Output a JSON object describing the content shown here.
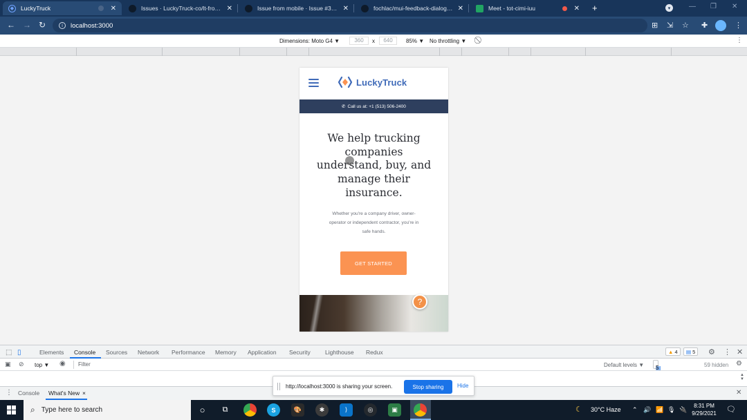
{
  "browser": {
    "tabs": [
      {
        "title": "LuckyTruck",
        "active": true
      },
      {
        "title": "Issues · LuckyTruck-co/lt-frontend",
        "active": false
      },
      {
        "title": "Issue from mobile · Issue #32 · LuckyTruck-co",
        "active": false
      },
      {
        "title": "fochlac/mui-feedback-dialog: A React",
        "active": false
      },
      {
        "title": "Meet - tot-cimi-iuu",
        "active": false
      }
    ],
    "new_tab": "+",
    "url": "localhost:3000"
  },
  "device_toolbar": {
    "dimensions_label": "Dimensions: Moto G4 ▼",
    "width": "360",
    "times": "x",
    "height": "640",
    "zoom": "85% ▼",
    "throttle": "No throttling ▼"
  },
  "site": {
    "brand": "LuckyTruck",
    "call_bar": "Call us at: +1 (513) 506-2400",
    "hero_lines": [
      "We help trucking",
      "companies",
      "understand, buy, and",
      "manage their",
      "insurance."
    ],
    "sub_lines": [
      "Whether you're a company driver, owner-",
      "operator or independent contractor, you're in",
      "safe hands."
    ],
    "cta": "GET STARTED",
    "help": "?",
    "colors": {
      "brand": "#3f6ab8",
      "callbar": "#2e3f5e",
      "cta": "#fb9352"
    }
  },
  "devtools": {
    "tabs": [
      "Elements",
      "Console",
      "Sources",
      "Network",
      "Performance",
      "Memory",
      "Application",
      "Security",
      "Lighthouse",
      "Redux"
    ],
    "active_tab": "Console",
    "warnings": "4",
    "messages": "5",
    "context": "top ▼",
    "filter_placeholder": "Filter",
    "levels": "Default levels ▼",
    "issues": "5 Issues:",
    "issues_count": "5",
    "hidden": "59 hidden",
    "drawer_tabs": [
      "Console",
      "What's New"
    ],
    "drawer_close": "×"
  },
  "sharing": {
    "message": "http://localhost:3000 is sharing your screen.",
    "stop": "Stop sharing",
    "hide": "Hide"
  },
  "taskbar": {
    "search_placeholder": "Type here to search",
    "weather": "30°C  Haze",
    "time": "8:31 PM",
    "date": "9/29/2021"
  }
}
